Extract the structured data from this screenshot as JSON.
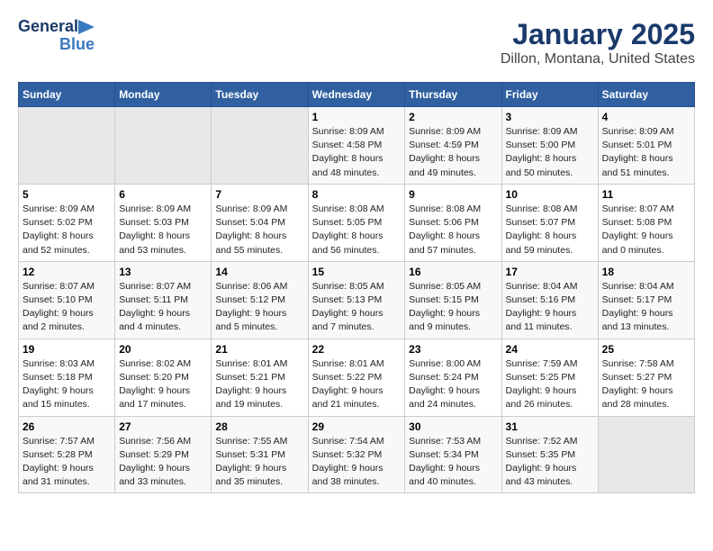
{
  "logo": {
    "line1": "General",
    "line2": "Blue"
  },
  "title": "January 2025",
  "subtitle": "Dillon, Montana, United States",
  "weekdays": [
    "Sunday",
    "Monday",
    "Tuesday",
    "Wednesday",
    "Thursday",
    "Friday",
    "Saturday"
  ],
  "weeks": [
    [
      {
        "day": "",
        "info": ""
      },
      {
        "day": "",
        "info": ""
      },
      {
        "day": "",
        "info": ""
      },
      {
        "day": "1",
        "info": "Sunrise: 8:09 AM\nSunset: 4:58 PM\nDaylight: 8 hours\nand 48 minutes."
      },
      {
        "day": "2",
        "info": "Sunrise: 8:09 AM\nSunset: 4:59 PM\nDaylight: 8 hours\nand 49 minutes."
      },
      {
        "day": "3",
        "info": "Sunrise: 8:09 AM\nSunset: 5:00 PM\nDaylight: 8 hours\nand 50 minutes."
      },
      {
        "day": "4",
        "info": "Sunrise: 8:09 AM\nSunset: 5:01 PM\nDaylight: 8 hours\nand 51 minutes."
      }
    ],
    [
      {
        "day": "5",
        "info": "Sunrise: 8:09 AM\nSunset: 5:02 PM\nDaylight: 8 hours\nand 52 minutes."
      },
      {
        "day": "6",
        "info": "Sunrise: 8:09 AM\nSunset: 5:03 PM\nDaylight: 8 hours\nand 53 minutes."
      },
      {
        "day": "7",
        "info": "Sunrise: 8:09 AM\nSunset: 5:04 PM\nDaylight: 8 hours\nand 55 minutes."
      },
      {
        "day": "8",
        "info": "Sunrise: 8:08 AM\nSunset: 5:05 PM\nDaylight: 8 hours\nand 56 minutes."
      },
      {
        "day": "9",
        "info": "Sunrise: 8:08 AM\nSunset: 5:06 PM\nDaylight: 8 hours\nand 57 minutes."
      },
      {
        "day": "10",
        "info": "Sunrise: 8:08 AM\nSunset: 5:07 PM\nDaylight: 8 hours\nand 59 minutes."
      },
      {
        "day": "11",
        "info": "Sunrise: 8:07 AM\nSunset: 5:08 PM\nDaylight: 9 hours\nand 0 minutes."
      }
    ],
    [
      {
        "day": "12",
        "info": "Sunrise: 8:07 AM\nSunset: 5:10 PM\nDaylight: 9 hours\nand 2 minutes."
      },
      {
        "day": "13",
        "info": "Sunrise: 8:07 AM\nSunset: 5:11 PM\nDaylight: 9 hours\nand 4 minutes."
      },
      {
        "day": "14",
        "info": "Sunrise: 8:06 AM\nSunset: 5:12 PM\nDaylight: 9 hours\nand 5 minutes."
      },
      {
        "day": "15",
        "info": "Sunrise: 8:05 AM\nSunset: 5:13 PM\nDaylight: 9 hours\nand 7 minutes."
      },
      {
        "day": "16",
        "info": "Sunrise: 8:05 AM\nSunset: 5:15 PM\nDaylight: 9 hours\nand 9 minutes."
      },
      {
        "day": "17",
        "info": "Sunrise: 8:04 AM\nSunset: 5:16 PM\nDaylight: 9 hours\nand 11 minutes."
      },
      {
        "day": "18",
        "info": "Sunrise: 8:04 AM\nSunset: 5:17 PM\nDaylight: 9 hours\nand 13 minutes."
      }
    ],
    [
      {
        "day": "19",
        "info": "Sunrise: 8:03 AM\nSunset: 5:18 PM\nDaylight: 9 hours\nand 15 minutes."
      },
      {
        "day": "20",
        "info": "Sunrise: 8:02 AM\nSunset: 5:20 PM\nDaylight: 9 hours\nand 17 minutes."
      },
      {
        "day": "21",
        "info": "Sunrise: 8:01 AM\nSunset: 5:21 PM\nDaylight: 9 hours\nand 19 minutes."
      },
      {
        "day": "22",
        "info": "Sunrise: 8:01 AM\nSunset: 5:22 PM\nDaylight: 9 hours\nand 21 minutes."
      },
      {
        "day": "23",
        "info": "Sunrise: 8:00 AM\nSunset: 5:24 PM\nDaylight: 9 hours\nand 24 minutes."
      },
      {
        "day": "24",
        "info": "Sunrise: 7:59 AM\nSunset: 5:25 PM\nDaylight: 9 hours\nand 26 minutes."
      },
      {
        "day": "25",
        "info": "Sunrise: 7:58 AM\nSunset: 5:27 PM\nDaylight: 9 hours\nand 28 minutes."
      }
    ],
    [
      {
        "day": "26",
        "info": "Sunrise: 7:57 AM\nSunset: 5:28 PM\nDaylight: 9 hours\nand 31 minutes."
      },
      {
        "day": "27",
        "info": "Sunrise: 7:56 AM\nSunset: 5:29 PM\nDaylight: 9 hours\nand 33 minutes."
      },
      {
        "day": "28",
        "info": "Sunrise: 7:55 AM\nSunset: 5:31 PM\nDaylight: 9 hours\nand 35 minutes."
      },
      {
        "day": "29",
        "info": "Sunrise: 7:54 AM\nSunset: 5:32 PM\nDaylight: 9 hours\nand 38 minutes."
      },
      {
        "day": "30",
        "info": "Sunrise: 7:53 AM\nSunset: 5:34 PM\nDaylight: 9 hours\nand 40 minutes."
      },
      {
        "day": "31",
        "info": "Sunrise: 7:52 AM\nSunset: 5:35 PM\nDaylight: 9 hours\nand 43 minutes."
      },
      {
        "day": "",
        "info": ""
      }
    ]
  ]
}
